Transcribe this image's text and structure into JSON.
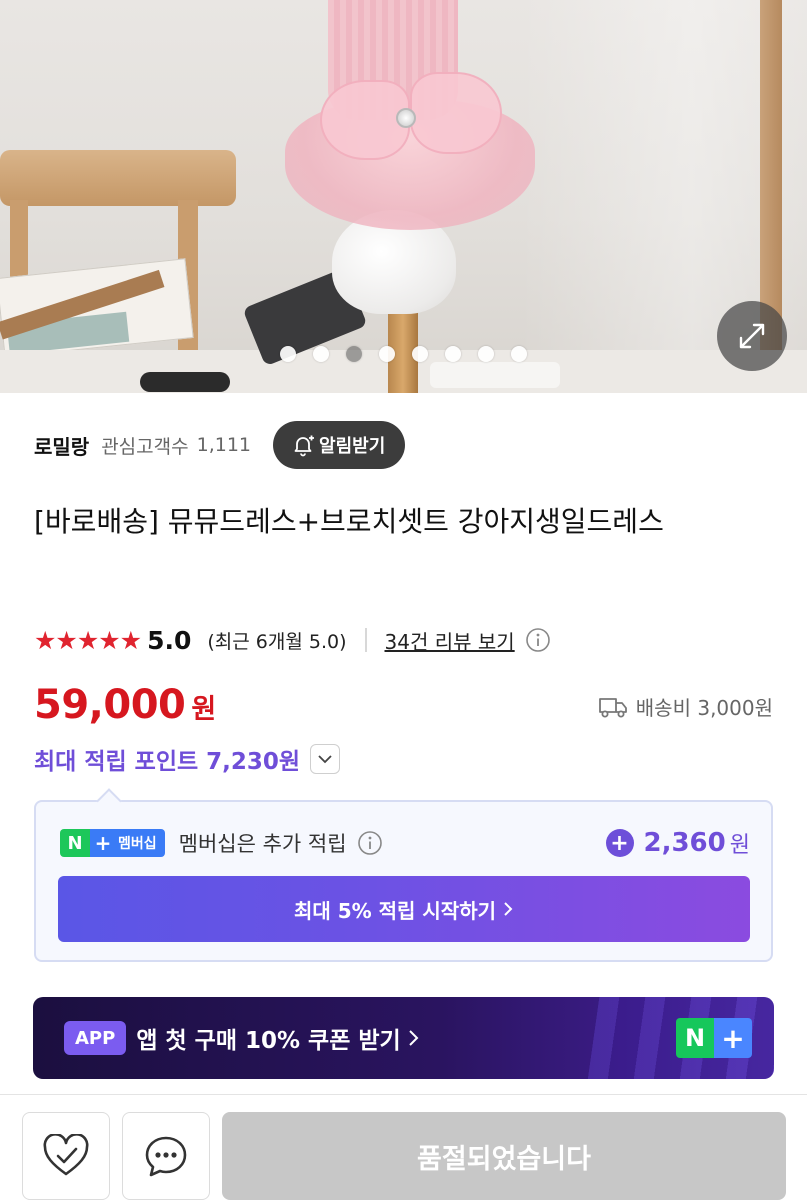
{
  "gallery": {
    "total_images": 8,
    "active_index": 3,
    "expand_icon": "expand-arrows-icon"
  },
  "seller": {
    "name": "로밀랑",
    "watchers_label": "관심고객수",
    "watchers_count": "1,111",
    "notify_label": "알림받기",
    "notify_icon": "bell-plus-icon"
  },
  "product": {
    "title": "[바로배송] 뮤뮤드레스+브로치셋트 강아지생일드레스"
  },
  "rating": {
    "stars": 5,
    "score": "5.0",
    "recent": "(최근 6개월 5.0)",
    "reviews_link": "34건 리뷰 보기"
  },
  "price": {
    "amount": "59,000",
    "unit": "원",
    "shipping": "배송비 3,000원"
  },
  "points": {
    "label": "최대 적립 포인트 7,230원"
  },
  "membership": {
    "badge_n": "N",
    "badge_plus": "+",
    "badge_text": "멤버십",
    "text": "멤버십은 추가 적립",
    "bonus_amount": "2,360",
    "bonus_unit": "원",
    "cta": "최대 5% 적립 시작하기"
  },
  "app_banner": {
    "pill": "APP",
    "text": "앱 첫 구매 10% 쿠폰 받기",
    "badge_n": "N",
    "badge_plus": "+"
  },
  "bottom_bar": {
    "soldout_label": "품절되었습니다",
    "zzim_icon": "heart-check-icon",
    "talk_icon": "chat-bubble-icon"
  },
  "colors": {
    "price_red": "#d6171f",
    "star_red": "#e0242f",
    "points_purple": "#6f4ed8",
    "soldout_gray": "#c7c7c7"
  }
}
